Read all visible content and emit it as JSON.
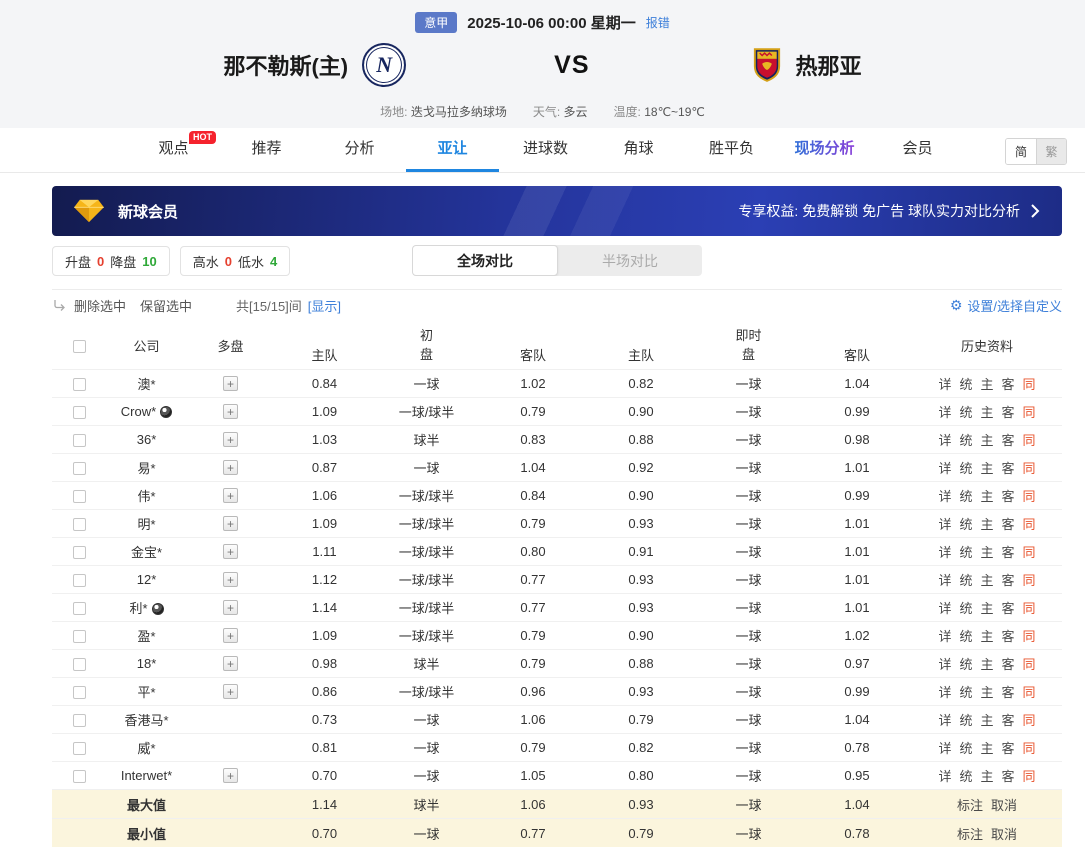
{
  "match_header": {
    "league": "意甲",
    "datetime": "2025-10-06 00:00 星期一",
    "report_error": "报错",
    "home_team": "那不勒斯(主)",
    "home_logo_letter": "N",
    "vs": "VS",
    "away_team": "热那亚",
    "venue_label": "场地:",
    "venue": "迭戈马拉多纳球场",
    "weather_label": "天气:",
    "weather": "多云",
    "temperature_label": "温度:",
    "temperature": "18℃~19℃"
  },
  "nav": {
    "tabs": [
      {
        "label": "观点",
        "badge": "HOT"
      },
      {
        "label": "推荐"
      },
      {
        "label": "分析"
      },
      {
        "label": "亚让"
      },
      {
        "label": "进球数"
      },
      {
        "label": "角球"
      },
      {
        "label": "胜平负"
      },
      {
        "label": "现场分析"
      },
      {
        "label": "会员"
      }
    ],
    "lang": {
      "simplified": "简",
      "traditional": "繁"
    }
  },
  "promo": {
    "title": "新球会员",
    "benefits": "专享权益: 免费解锁 免广告 球队实力对比分析"
  },
  "filters": {
    "groups": [
      {
        "items": [
          {
            "label": "升盘",
            "value": "0"
          },
          {
            "label": "降盘",
            "value": "10"
          }
        ]
      },
      {
        "items": [
          {
            "label": "高水",
            "value": "0"
          },
          {
            "label": "低水",
            "value": "4"
          }
        ]
      }
    ],
    "toggle": {
      "full": "全场对比",
      "half": "半场对比"
    }
  },
  "toolbar": {
    "delete_selected": "删除选中",
    "keep_selected": "保留选中",
    "count_text": "共[15/15]间",
    "show_link": "[显示]",
    "settings_link": "设置/选择自定义"
  },
  "table": {
    "headers": {
      "company": "公司",
      "multi": "多盘",
      "home": "主队",
      "line": "盘",
      "away": "客队",
      "init": "初",
      "live": "即时",
      "history": "历史资料"
    },
    "history_links": [
      "详",
      "统",
      "主",
      "客"
    ],
    "same_label": "同",
    "rows": [
      {
        "company": "澳*",
        "icon": false,
        "multi": true,
        "init": [
          "0.84",
          "一球",
          "1.02"
        ],
        "live": [
          "0.82",
          "一球",
          "1.04"
        ]
      },
      {
        "company": "Crow*",
        "icon": true,
        "multi": true,
        "init": [
          "1.09",
          "一球/球半",
          "0.79"
        ],
        "live": [
          "0.90",
          "一球",
          "0.99"
        ]
      },
      {
        "company": "36*",
        "icon": false,
        "multi": true,
        "init": [
          "1.03",
          "球半",
          "0.83"
        ],
        "live": [
          "0.88",
          "一球",
          "0.98"
        ]
      },
      {
        "company": "易*",
        "icon": false,
        "multi": true,
        "init": [
          "0.87",
          "一球",
          "1.04"
        ],
        "live": [
          "0.92",
          "一球",
          "1.01"
        ]
      },
      {
        "company": "伟*",
        "icon": false,
        "multi": true,
        "init": [
          "1.06",
          "一球/球半",
          "0.84"
        ],
        "live": [
          "0.90",
          "一球",
          "0.99"
        ]
      },
      {
        "company": "明*",
        "icon": false,
        "multi": true,
        "init": [
          "1.09",
          "一球/球半",
          "0.79"
        ],
        "live": [
          "0.93",
          "一球",
          "1.01"
        ]
      },
      {
        "company": "金宝*",
        "icon": false,
        "multi": true,
        "init": [
          "1.11",
          "一球/球半",
          "0.80"
        ],
        "live": [
          "0.91",
          "一球",
          "1.01"
        ]
      },
      {
        "company": "12*",
        "icon": false,
        "multi": true,
        "init": [
          "1.12",
          "一球/球半",
          "0.77"
        ],
        "live": [
          "0.93",
          "一球",
          "1.01"
        ]
      },
      {
        "company": "利*",
        "icon": true,
        "multi": true,
        "init": [
          "1.14",
          "一球/球半",
          "0.77"
        ],
        "live": [
          "0.93",
          "一球",
          "1.01"
        ]
      },
      {
        "company": "盈*",
        "icon": false,
        "multi": true,
        "init": [
          "1.09",
          "一球/球半",
          "0.79"
        ],
        "live": [
          "0.90",
          "一球",
          "1.02"
        ]
      },
      {
        "company": "18*",
        "icon": false,
        "multi": true,
        "init": [
          "0.98",
          "球半",
          "0.79"
        ],
        "live": [
          "0.88",
          "一球",
          "0.97"
        ]
      },
      {
        "company": "平*",
        "icon": false,
        "multi": true,
        "init": [
          "0.86",
          "一球/球半",
          "0.96"
        ],
        "live": [
          "0.93",
          "一球",
          "0.99"
        ]
      },
      {
        "company": "香港马*",
        "icon": false,
        "multi": false,
        "init": [
          "0.73",
          "一球",
          "1.06"
        ],
        "live": [
          "0.79",
          "一球",
          "1.04"
        ]
      },
      {
        "company": "威*",
        "icon": false,
        "multi": false,
        "init": [
          "0.81",
          "一球",
          "0.79"
        ],
        "live": [
          "0.82",
          "一球",
          "0.78"
        ]
      },
      {
        "company": "Interwet*",
        "icon": false,
        "multi": true,
        "init": [
          "0.70",
          "一球",
          "1.05"
        ],
        "live": [
          "0.80",
          "一球",
          "0.95"
        ]
      }
    ],
    "summary": [
      {
        "label": "最大值",
        "init": [
          "1.14",
          "球半",
          "1.06"
        ],
        "live": [
          "0.93",
          "一球",
          "1.04"
        ],
        "actions": [
          "标注",
          "取消"
        ]
      },
      {
        "label": "最小值",
        "init": [
          "0.70",
          "一球",
          "0.77"
        ],
        "live": [
          "0.79",
          "一球",
          "0.78"
        ],
        "actions": [
          "标注",
          "取消"
        ]
      }
    ]
  },
  "colors": {
    "accent_blue": "#1f86e0",
    "link_blue": "#3d7fd9",
    "up_red": "#e5402f",
    "down_green": "#2fa838",
    "same_orange": "#e8542e",
    "banner_navy": "#24349b",
    "badge_blue": "#5b79c8",
    "hot_red": "#f5222d",
    "summary_yellow": "#fbf5dd"
  }
}
